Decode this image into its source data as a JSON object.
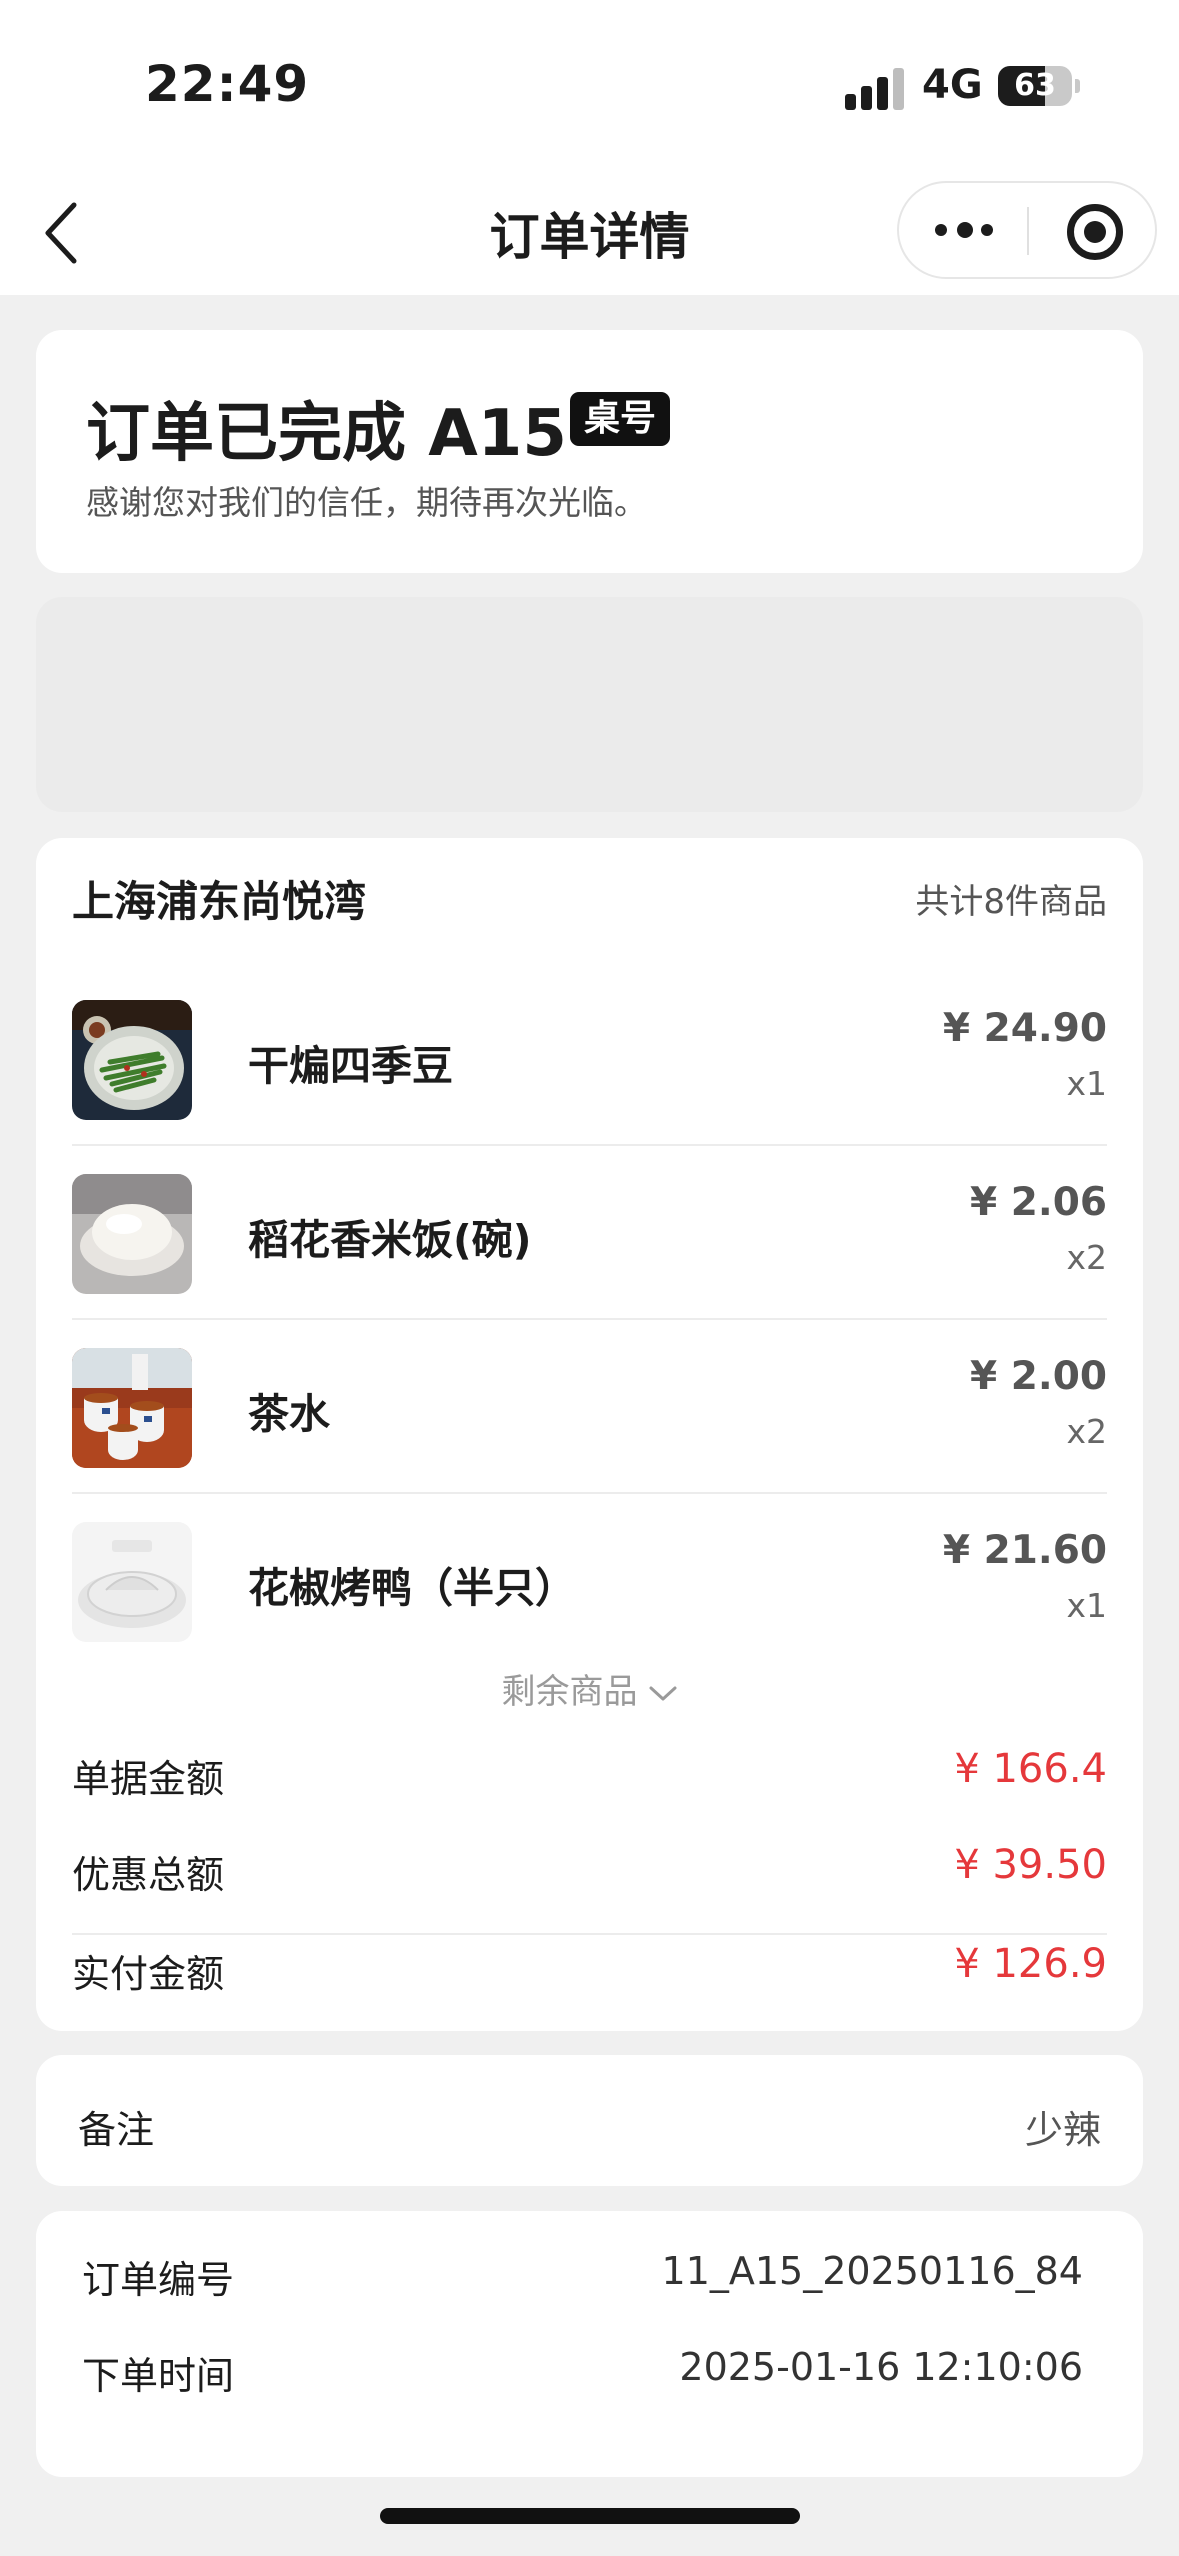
{
  "status_bar": {
    "time": "22:49",
    "network": "4G",
    "battery": "63",
    "battery_level": 0.63
  },
  "nav": {
    "title": "订单详情"
  },
  "order_status": {
    "title": "订单已完成 A15",
    "badge": "桌号",
    "subtitle": "感谢您对我们的信任，期待再次光临。"
  },
  "store": {
    "name": "上海浦东尚悦湾",
    "count_text": "共计8件商品"
  },
  "items": [
    {
      "name": "干煸四季豆",
      "price": "¥ 24.90",
      "qty": "x1",
      "image": "green-beans-dish"
    },
    {
      "name": "稻花香米饭(碗)",
      "price": "¥ 2.06",
      "qty": "x2",
      "image": "rice-bowl"
    },
    {
      "name": "茶水",
      "price": "¥ 2.00",
      "qty": "x2",
      "image": "tea-cups"
    },
    {
      "name": "花椒烤鸭（半只）",
      "price": "¥ 21.60",
      "qty": "x1",
      "image": "no-image-placeholder"
    }
  ],
  "more_items_label": "剩余商品",
  "summary": {
    "bill_label": "单据金额",
    "bill_value": "¥ 166.4",
    "discount_label": "优惠总额",
    "discount_value": "¥ 39.50",
    "paid_label": "实付金额",
    "paid_value": "¥ 126.9"
  },
  "remark": {
    "label": "备注",
    "value": "少辣"
  },
  "order_info": {
    "number_label": "订单编号",
    "number_value": "11_A15_20250116_84",
    "time_label": "下单时间",
    "time_value": "2025-01-16 12:10:06"
  },
  "colors": {
    "accent_red": "#e5383b",
    "page_bg": "#f0f0f0"
  }
}
